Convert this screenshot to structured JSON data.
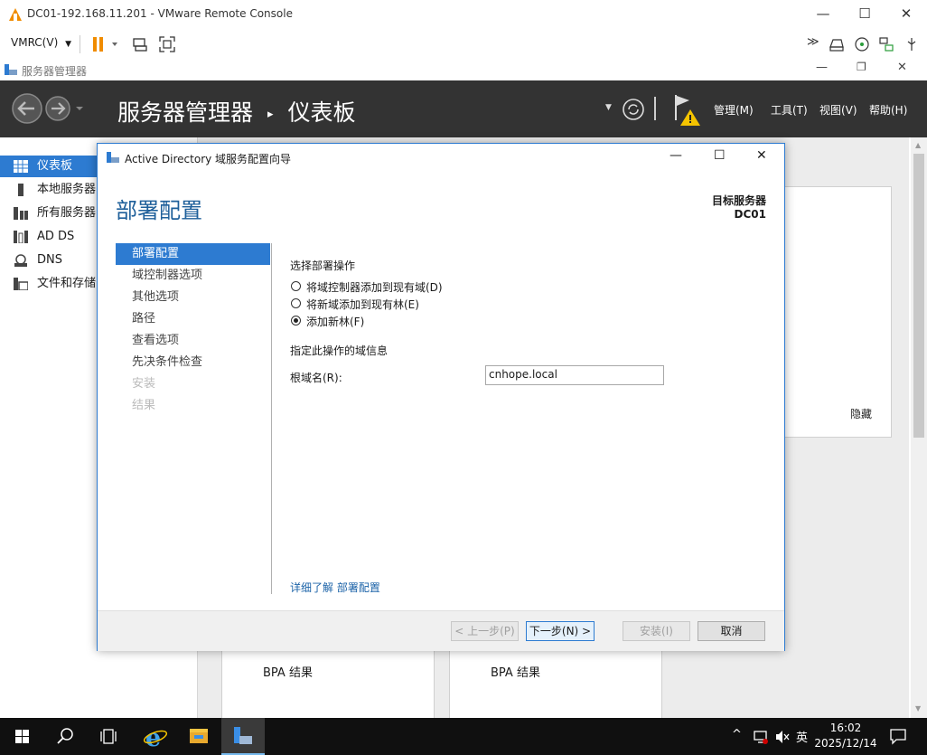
{
  "vmrc": {
    "title": "DC01-192.168.11.201 - VMware Remote Console",
    "menu_label": "VMRC(V)",
    "win_min": "—",
    "win_max": "☐",
    "win_close": "✕"
  },
  "server_manager": {
    "window_title": "服务器管理器",
    "breadcrumb_app": "服务器管理器",
    "breadcrumb_sep": "▸",
    "breadcrumb_page": "仪表板",
    "menus": [
      "管理(M)",
      "工具(T)",
      "视图(V)",
      "帮助(H)"
    ],
    "nav": [
      {
        "label": "仪表板",
        "icon": "dashboard-icon",
        "active": true
      },
      {
        "label": "本地服务器",
        "icon": "server-icon"
      },
      {
        "label": "所有服务器",
        "icon": "servers-icon"
      },
      {
        "label": "AD DS",
        "icon": "ad-ds-icon"
      },
      {
        "label": "DNS",
        "icon": "dns-icon"
      },
      {
        "label": "文件和存储",
        "icon": "file-storage-icon"
      }
    ],
    "hide_label": "隐藏",
    "bpa_labels": [
      "BPA 结果",
      "BPA 结果"
    ]
  },
  "wizard": {
    "title": "Active Directory 域服务配置向导",
    "heading": "部署配置",
    "target_label": "目标服务器",
    "target_name": "DC01",
    "steps": [
      {
        "label": "部署配置",
        "state": "active"
      },
      {
        "label": "域控制器选项",
        "state": "normal"
      },
      {
        "label": "其他选项",
        "state": "normal"
      },
      {
        "label": "路径",
        "state": "normal"
      },
      {
        "label": "查看选项",
        "state": "normal"
      },
      {
        "label": "先决条件检查",
        "state": "normal"
      },
      {
        "label": "安装",
        "state": "disabled"
      },
      {
        "label": "结果",
        "state": "disabled"
      }
    ],
    "section_label": "选择部署操作",
    "options": [
      {
        "label": "将域控制器添加到现有域(D)",
        "selected": false
      },
      {
        "label": "将新域添加到现有林(E)",
        "selected": false
      },
      {
        "label": "添加新林(F)",
        "selected": true
      }
    ],
    "domain_info_label": "指定此操作的域信息",
    "root_domain_label": "根域名(R):",
    "root_domain_value": "cnhope.local",
    "learn_more_link": "详细了解 部署配置",
    "buttons": {
      "prev": "< 上一步(P)",
      "next": "下一步(N) >",
      "install": "安装(I)",
      "cancel": "取消"
    }
  },
  "taskbar": {
    "time": "16:02",
    "date": "2025/12/14",
    "ime": "英"
  },
  "colors": {
    "accent": "#2d7bd1",
    "header_bg": "#333333",
    "orange": "#f08c00"
  }
}
